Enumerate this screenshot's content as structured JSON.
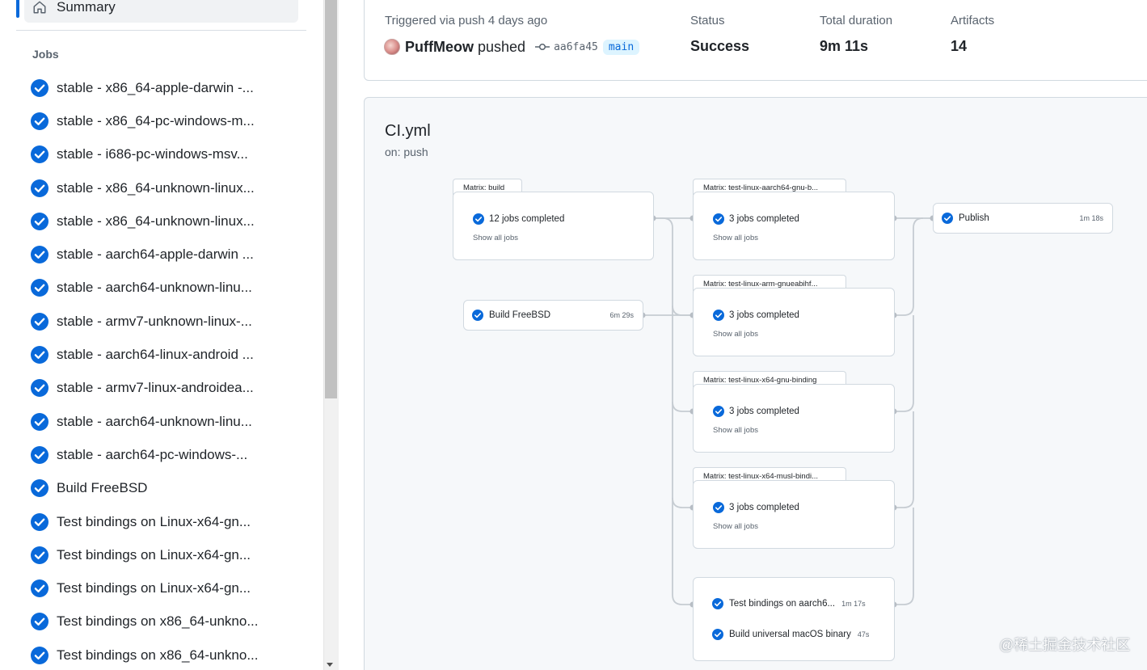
{
  "sidebar": {
    "summary_label": "Summary",
    "jobs_heading": "Jobs",
    "jobs": [
      "stable - x86_64-apple-darwin -...",
      "stable - x86_64-pc-windows-m...",
      "stable - i686-pc-windows-msv...",
      "stable - x86_64-unknown-linux...",
      "stable - x86_64-unknown-linux...",
      "stable - aarch64-apple-darwin ...",
      "stable - aarch64-unknown-linu...",
      "stable - armv7-unknown-linux-...",
      "stable - aarch64-linux-android ...",
      "stable - armv7-linux-androidea...",
      "stable - aarch64-unknown-linu...",
      "stable - aarch64-pc-windows-...",
      "Build FreeBSD",
      "Test bindings on Linux-x64-gn...",
      "Test bindings on Linux-x64-gn...",
      "Test bindings on Linux-x64-gn...",
      "Test bindings on x86_64-unkno...",
      "Test bindings on x86_64-unkno..."
    ]
  },
  "run": {
    "trigger_label": "Triggered via push 4 days ago",
    "user": "PuffMeow",
    "action": "pushed",
    "commit_sha": "aa6fa45",
    "branch": "main",
    "status_label": "Status",
    "status_value": "Success",
    "duration_label": "Total duration",
    "duration_value": "9m 11s",
    "artifacts_label": "Artifacts",
    "artifacts_value": "14"
  },
  "workflow": {
    "file": "CI.yml",
    "event": "on: push",
    "matrix_build": {
      "tab": "Matrix: build",
      "status": "12 jobs completed",
      "link": "Show all jobs"
    },
    "build_freebsd": {
      "name": "Build FreeBSD",
      "duration": "6m 29s"
    },
    "matrix_aarch64": {
      "tab": "Matrix: test-linux-aarch64-gnu-b...",
      "status": "3 jobs completed",
      "link": "Show all jobs"
    },
    "matrix_arm": {
      "tab": "Matrix: test-linux-arm-gnueabihf...",
      "status": "3 jobs completed",
      "link": "Show all jobs"
    },
    "matrix_x64_gnu": {
      "tab": "Matrix: test-linux-x64-gnu-binding",
      "status": "3 jobs completed",
      "link": "Show all jobs"
    },
    "matrix_x64_musl": {
      "tab": "Matrix: test-linux-x64-musl-bindi...",
      "status": "3 jobs completed",
      "link": "Show all jobs"
    },
    "test_aarch6": {
      "name": "Test bindings on aarch6...",
      "duration": "1m 17s"
    },
    "universal_macos": {
      "name": "Build universal macOS binary",
      "duration": "47s"
    },
    "publish": {
      "name": "Publish",
      "duration": "1m 18s"
    }
  },
  "watermark": "@稀土掘金技术社区",
  "colors": {
    "accent": "#0969da",
    "success_icon": "#0969da",
    "border": "#d1d9e0"
  }
}
